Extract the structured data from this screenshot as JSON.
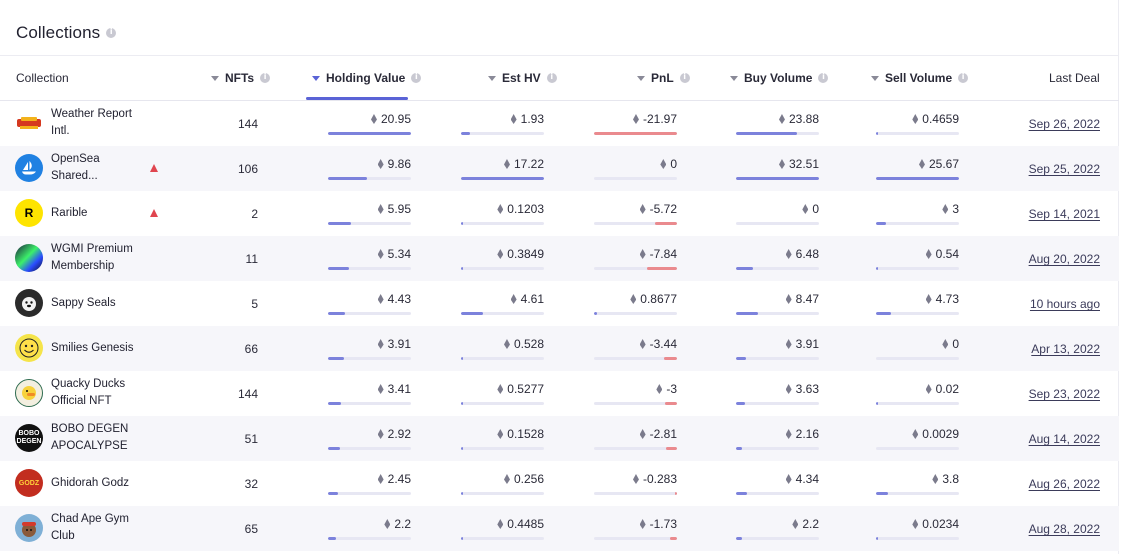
{
  "title": "Collections",
  "colors": {
    "accent": "#5a63d6",
    "bar_positive": "#7c82dc",
    "bar_negative": "#ea8a8e",
    "warning": "#e0454f"
  },
  "columns": {
    "collection": "Collection",
    "nfts": "NFTs",
    "holding_value": "Holding Value",
    "est_hv": "Est HV",
    "pnl": "PnL",
    "buy_volume": "Buy Volume",
    "sell_volume": "Sell Volume",
    "last_deal": "Last Deal"
  },
  "sorted_column": "holding_value",
  "rows": [
    {
      "name": "Weather Report Intl.",
      "avatar": "weather-report-logo",
      "warning": false,
      "nfts": "144",
      "holding_value": "20.95",
      "hv_bar": 1.0,
      "est_hv": "1.93",
      "est_bar": 0.11,
      "pnl": "-21.97",
      "pnl_bar": -1.0,
      "buy": "23.88",
      "buy_bar": 0.73,
      "sell": "0.4659",
      "sell_bar": 0.02,
      "last_deal": "Sep 26, 2022"
    },
    {
      "name": "OpenSea Shared...",
      "avatar": "opensea-logo",
      "warning": true,
      "nfts": "106",
      "holding_value": "9.86",
      "hv_bar": 0.47,
      "est_hv": "17.22",
      "est_bar": 1.0,
      "pnl": "0",
      "pnl_bar": 0,
      "buy": "32.51",
      "buy_bar": 1.0,
      "sell": "25.67",
      "sell_bar": 1.0,
      "last_deal": "Sep 25, 2022"
    },
    {
      "name": "Rarible",
      "avatar": "rarible-logo",
      "warning": true,
      "nfts": "2",
      "holding_value": "5.95",
      "hv_bar": 0.28,
      "est_hv": "0.1203",
      "est_bar": 0.01,
      "pnl": "-5.72",
      "pnl_bar": -0.26,
      "buy": "0",
      "buy_bar": 0,
      "sell": "3",
      "sell_bar": 0.12,
      "last_deal": "Sep 14, 2021"
    },
    {
      "name": "WGMI Premium Membership",
      "avatar": "wgmi-logo",
      "warning": false,
      "nfts": "11",
      "holding_value": "5.34",
      "hv_bar": 0.25,
      "est_hv": "0.3849",
      "est_bar": 0.02,
      "pnl": "-7.84",
      "pnl_bar": -0.36,
      "buy": "6.48",
      "buy_bar": 0.2,
      "sell": "0.54",
      "sell_bar": 0.02,
      "last_deal": "Aug 20, 2022"
    },
    {
      "name": "Sappy Seals",
      "avatar": "sappy-seals-logo",
      "warning": false,
      "nfts": "5",
      "holding_value": "4.43",
      "hv_bar": 0.21,
      "est_hv": "4.61",
      "est_bar": 0.27,
      "pnl": "0.8677",
      "pnl_bar": 0.04,
      "buy": "8.47",
      "buy_bar": 0.26,
      "sell": "4.73",
      "sell_bar": 0.18,
      "last_deal": "10 hours ago"
    },
    {
      "name": "Smilies Genesis",
      "avatar": "smilies-logo",
      "warning": false,
      "nfts": "66",
      "holding_value": "3.91",
      "hv_bar": 0.19,
      "est_hv": "0.528",
      "est_bar": 0.03,
      "pnl": "-3.44",
      "pnl_bar": -0.16,
      "buy": "3.91",
      "buy_bar": 0.12,
      "sell": "0",
      "sell_bar": 0,
      "last_deal": "Apr 13, 2022"
    },
    {
      "name": "Quacky Ducks Official NFT",
      "avatar": "quacky-ducks-logo",
      "warning": false,
      "nfts": "144",
      "holding_value": "3.41",
      "hv_bar": 0.16,
      "est_hv": "0.5277",
      "est_bar": 0.03,
      "pnl": "-3",
      "pnl_bar": -0.14,
      "buy": "3.63",
      "buy_bar": 0.11,
      "sell": "0.02",
      "sell_bar": 0.01,
      "last_deal": "Sep 23, 2022"
    },
    {
      "name": "BOBO DEGEN APOCALYPSE",
      "avatar": "bobo-degen-logo",
      "warning": false,
      "nfts": "51",
      "holding_value": "2.92",
      "hv_bar": 0.14,
      "est_hv": "0.1528",
      "est_bar": 0.01,
      "pnl": "-2.81",
      "pnl_bar": -0.13,
      "buy": "2.16",
      "buy_bar": 0.07,
      "sell": "0.0029",
      "sell_bar": 0.0,
      "last_deal": "Aug 14, 2022"
    },
    {
      "name": "Ghidorah Godz",
      "avatar": "ghidorah-godz-logo",
      "warning": false,
      "nfts": "32",
      "holding_value": "2.45",
      "hv_bar": 0.12,
      "est_hv": "0.256",
      "est_bar": 0.02,
      "pnl": "-0.283",
      "pnl_bar": -0.01,
      "buy": "4.34",
      "buy_bar": 0.13,
      "sell": "3.8",
      "sell_bar": 0.15,
      "last_deal": "Aug 26, 2022"
    },
    {
      "name": "Chad Ape Gym Club",
      "avatar": "chad-ape-logo",
      "warning": false,
      "nfts": "65",
      "holding_value": "2.2",
      "hv_bar": 0.1,
      "est_hv": "0.4485",
      "est_bar": 0.03,
      "pnl": "-1.73",
      "pnl_bar": -0.08,
      "buy": "2.2",
      "buy_bar": 0.07,
      "sell": "0.0234",
      "sell_bar": 0.01,
      "last_deal": "Aug 28, 2022"
    }
  ]
}
